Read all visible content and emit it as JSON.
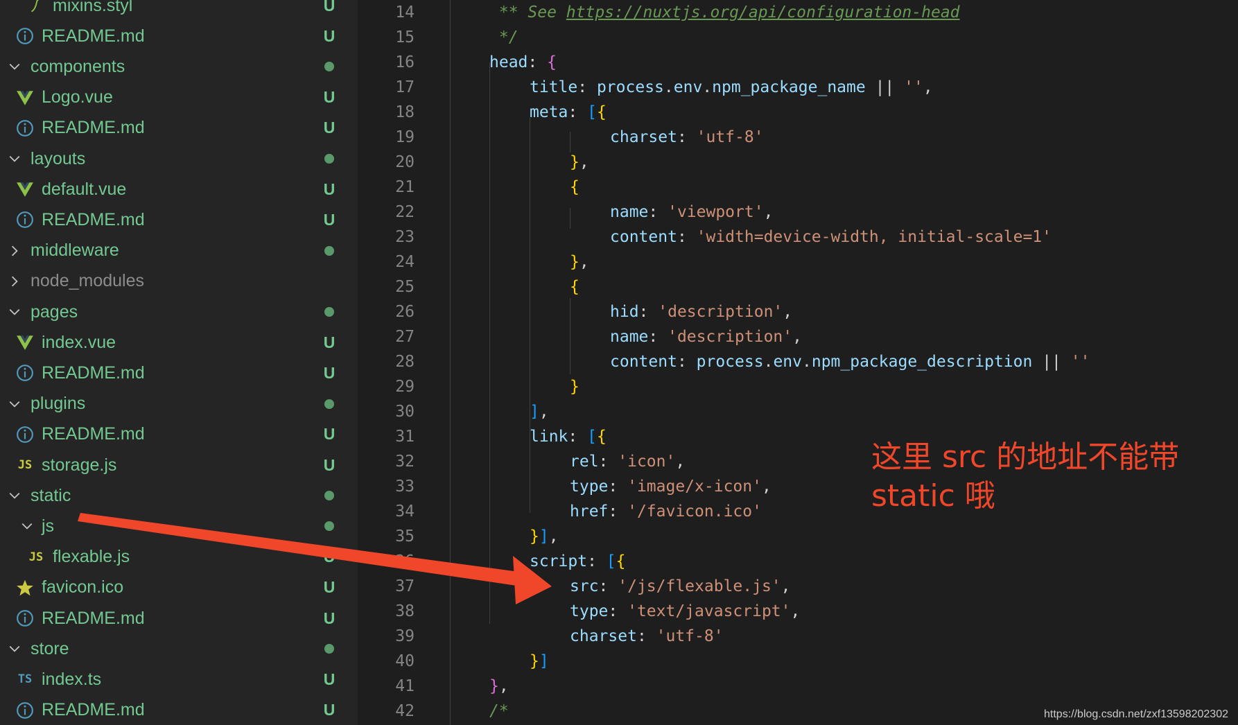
{
  "colors": {
    "sidebar_bg": "#252526",
    "editor_bg": "#1e1e1e",
    "untracked_green": "#73c991",
    "folder_dot": "#5a9a6a",
    "annotation_red": "#f0462a"
  },
  "explorer": {
    "rows": [
      {
        "kind": "file",
        "name": "mixins.styl",
        "icon": "stylus-icon",
        "status": "U",
        "depth": 1
      },
      {
        "kind": "file",
        "name": "README.md",
        "icon": "info-icon",
        "status": "U",
        "depth": 0
      },
      {
        "kind": "folder",
        "name": "components",
        "expanded": true,
        "status": "dot"
      },
      {
        "kind": "file",
        "name": "Logo.vue",
        "icon": "vue-icon",
        "status": "U",
        "depth": 0
      },
      {
        "kind": "file",
        "name": "README.md",
        "icon": "info-icon",
        "status": "U",
        "depth": 0
      },
      {
        "kind": "folder",
        "name": "layouts",
        "expanded": true,
        "status": "dot"
      },
      {
        "kind": "file",
        "name": "default.vue",
        "icon": "vue-icon",
        "status": "U",
        "depth": 0
      },
      {
        "kind": "file",
        "name": "README.md",
        "icon": "info-icon",
        "status": "U",
        "depth": 0
      },
      {
        "kind": "folder",
        "name": "middleware",
        "expanded": false,
        "status": "dot"
      },
      {
        "kind": "folder",
        "name": "node_modules",
        "expanded": false,
        "status": "",
        "dim": true
      },
      {
        "kind": "folder",
        "name": "pages",
        "expanded": true,
        "status": "dot"
      },
      {
        "kind": "file",
        "name": "index.vue",
        "icon": "vue-icon",
        "status": "U",
        "depth": 0
      },
      {
        "kind": "file",
        "name": "README.md",
        "icon": "info-icon",
        "status": "U",
        "depth": 0
      },
      {
        "kind": "folder",
        "name": "plugins",
        "expanded": true,
        "status": "dot"
      },
      {
        "kind": "file",
        "name": "README.md",
        "icon": "info-icon",
        "status": "U",
        "depth": 0
      },
      {
        "kind": "file",
        "name": "storage.js",
        "icon": "js-icon",
        "status": "U",
        "depth": 0
      },
      {
        "kind": "folder",
        "name": "static",
        "expanded": true,
        "status": "dot"
      },
      {
        "kind": "subfolder",
        "name": "js",
        "expanded": true,
        "status": "dot"
      },
      {
        "kind": "file",
        "name": "flexable.js",
        "icon": "js-icon",
        "status": "U",
        "depth": 1
      },
      {
        "kind": "file",
        "name": "favicon.ico",
        "icon": "star-icon",
        "status": "U",
        "depth": 0
      },
      {
        "kind": "file",
        "name": "README.md",
        "icon": "info-icon",
        "status": "U",
        "depth": 0
      },
      {
        "kind": "folder",
        "name": "store",
        "expanded": true,
        "status": "dot"
      },
      {
        "kind": "file",
        "name": "index.ts",
        "icon": "ts-icon",
        "status": "U",
        "depth": 0
      },
      {
        "kind": "file",
        "name": "README.md",
        "icon": "info-icon",
        "status": "U",
        "depth": 0
      }
    ]
  },
  "editor": {
    "lines": [
      {
        "n": "14",
        "indent": 0,
        "tokens": [
          [
            "cm",
            " ** See "
          ],
          [
            "link",
            "https://nuxtjs.org/api/configuration-head"
          ]
        ]
      },
      {
        "n": "15",
        "indent": 0,
        "tokens": [
          [
            "cm",
            " */"
          ]
        ]
      },
      {
        "n": "16",
        "indent": 0,
        "tokens": [
          [
            "key",
            "head"
          ],
          [
            "op",
            ": "
          ],
          [
            "b1",
            "{"
          ]
        ]
      },
      {
        "n": "17",
        "indent": 1,
        "tokens": [
          [
            "key",
            "title"
          ],
          [
            "op",
            ": "
          ],
          [
            "key",
            "process"
          ],
          [
            "op",
            "."
          ],
          [
            "key",
            "env"
          ],
          [
            "op",
            "."
          ],
          [
            "key",
            "npm_package_name"
          ],
          [
            "op",
            " || "
          ],
          [
            "str",
            "''"
          ],
          [
            "op",
            ","
          ]
        ]
      },
      {
        "n": "18",
        "indent": 1,
        "tokens": [
          [
            "key",
            "meta"
          ],
          [
            "op",
            ": "
          ],
          [
            "b3",
            "["
          ],
          [
            "b2",
            "{"
          ]
        ]
      },
      {
        "n": "19",
        "indent": 3,
        "tokens": [
          [
            "key",
            "charset"
          ],
          [
            "op",
            ": "
          ],
          [
            "str",
            "'utf-8'"
          ]
        ]
      },
      {
        "n": "20",
        "indent": 2,
        "tokens": [
          [
            "b2",
            "}"
          ],
          [
            "op",
            ","
          ]
        ]
      },
      {
        "n": "21",
        "indent": 2,
        "tokens": [
          [
            "b2",
            "{"
          ]
        ]
      },
      {
        "n": "22",
        "indent": 3,
        "tokens": [
          [
            "key",
            "name"
          ],
          [
            "op",
            ": "
          ],
          [
            "str",
            "'viewport'"
          ],
          [
            "op",
            ","
          ]
        ]
      },
      {
        "n": "23",
        "indent": 3,
        "tokens": [
          [
            "key",
            "content"
          ],
          [
            "op",
            ": "
          ],
          [
            "str",
            "'width=device-width, initial-scale=1'"
          ]
        ]
      },
      {
        "n": "24",
        "indent": 2,
        "tokens": [
          [
            "b2",
            "}"
          ],
          [
            "op",
            ","
          ]
        ]
      },
      {
        "n": "25",
        "indent": 2,
        "tokens": [
          [
            "b2",
            "{"
          ]
        ]
      },
      {
        "n": "26",
        "indent": 3,
        "tokens": [
          [
            "key",
            "hid"
          ],
          [
            "op",
            ": "
          ],
          [
            "str",
            "'description'"
          ],
          [
            "op",
            ","
          ]
        ]
      },
      {
        "n": "27",
        "indent": 3,
        "tokens": [
          [
            "key",
            "name"
          ],
          [
            "op",
            ": "
          ],
          [
            "str",
            "'description'"
          ],
          [
            "op",
            ","
          ]
        ]
      },
      {
        "n": "28",
        "indent": 3,
        "tokens": [
          [
            "key",
            "content"
          ],
          [
            "op",
            ": "
          ],
          [
            "key",
            "process"
          ],
          [
            "op",
            "."
          ],
          [
            "key",
            "env"
          ],
          [
            "op",
            "."
          ],
          [
            "key",
            "npm_package_description"
          ],
          [
            "op",
            " || "
          ],
          [
            "str",
            "''"
          ]
        ]
      },
      {
        "n": "29",
        "indent": 2,
        "tokens": [
          [
            "b2",
            "}"
          ]
        ]
      },
      {
        "n": "30",
        "indent": 1,
        "tokens": [
          [
            "b3",
            "]"
          ],
          [
            "op",
            ","
          ]
        ]
      },
      {
        "n": "31",
        "indent": 1,
        "tokens": [
          [
            "key",
            "link"
          ],
          [
            "op",
            ": "
          ],
          [
            "b3",
            "["
          ],
          [
            "b2",
            "{"
          ]
        ]
      },
      {
        "n": "32",
        "indent": 2,
        "tokens": [
          [
            "key",
            "rel"
          ],
          [
            "op",
            ": "
          ],
          [
            "str",
            "'icon'"
          ],
          [
            "op",
            ","
          ]
        ]
      },
      {
        "n": "33",
        "indent": 2,
        "tokens": [
          [
            "key",
            "type"
          ],
          [
            "op",
            ": "
          ],
          [
            "str",
            "'image/x-icon'"
          ],
          [
            "op",
            ","
          ]
        ]
      },
      {
        "n": "34",
        "indent": 2,
        "tokens": [
          [
            "key",
            "href"
          ],
          [
            "op",
            ": "
          ],
          [
            "str",
            "'/favicon.ico'"
          ]
        ]
      },
      {
        "n": "35",
        "indent": 1,
        "tokens": [
          [
            "b2",
            "}"
          ],
          [
            "b3",
            "]"
          ],
          [
            "op",
            ","
          ]
        ]
      },
      {
        "n": "36",
        "indent": 1,
        "tokens": [
          [
            "key",
            "script"
          ],
          [
            "op",
            ": "
          ],
          [
            "b3",
            "["
          ],
          [
            "b2",
            "{"
          ]
        ]
      },
      {
        "n": "37",
        "indent": 2,
        "tokens": [
          [
            "key",
            "src"
          ],
          [
            "op",
            ": "
          ],
          [
            "str",
            "'/js/flexable.js'"
          ],
          [
            "op",
            ","
          ]
        ]
      },
      {
        "n": "38",
        "indent": 2,
        "tokens": [
          [
            "key",
            "type"
          ],
          [
            "op",
            ": "
          ],
          [
            "str",
            "'text/javascript'"
          ],
          [
            "op",
            ","
          ]
        ]
      },
      {
        "n": "39",
        "indent": 2,
        "tokens": [
          [
            "key",
            "charset"
          ],
          [
            "op",
            ": "
          ],
          [
            "str",
            "'utf-8'"
          ]
        ]
      },
      {
        "n": "40",
        "indent": 1,
        "tokens": [
          [
            "b2",
            "}"
          ],
          [
            "b3",
            "]"
          ]
        ]
      },
      {
        "n": "41",
        "indent": 0,
        "tokens": [
          [
            "b1",
            "}"
          ],
          [
            "op",
            ","
          ]
        ]
      },
      {
        "n": "42",
        "indent": 0,
        "tokens": [
          [
            "cm",
            "/*"
          ]
        ]
      }
    ]
  },
  "annotation": {
    "line1": "这里 src 的地址不能带",
    "line2": "static 哦"
  },
  "watermark": "https://blog.csdn.net/zxf13598202302"
}
